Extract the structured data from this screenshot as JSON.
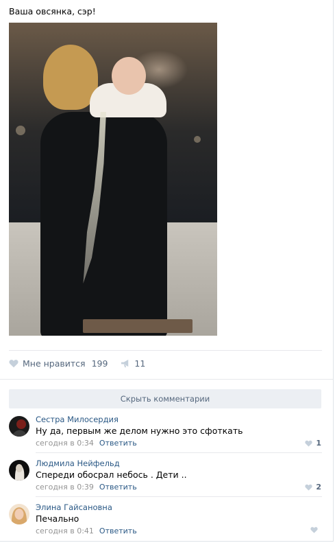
{
  "post": {
    "text": "Ваша овсянка, сэр!",
    "photo_icon": "post-photo"
  },
  "actions": {
    "like_label": "Мне нравится",
    "like_count": "199",
    "share_count": "11",
    "like_icon": "heart-icon",
    "share_icon": "megaphone-icon"
  },
  "comments_toggle": {
    "label": "Скрыть комментарии"
  },
  "comments": [
    {
      "author": "Сестра Милосердия",
      "text": "Ну да, первым же делом нужно это сфоткать",
      "time": "сегодня в 0:34",
      "reply_label": "Ответить",
      "likes": "1"
    },
    {
      "author": "Людмила Нейфельд",
      "text": "Спереди обосрал небось . Дети ..",
      "time": "сегодня в 0:39",
      "reply_label": "Ответить",
      "likes": "2"
    },
    {
      "author": "Элина Гайсановна",
      "text": "Печально",
      "time": "сегодня в 0:41",
      "reply_label": "Ответить",
      "likes": ""
    }
  ],
  "colors": {
    "link": "#2a5885",
    "muted": "#939393",
    "icon": "#55677d",
    "button_bg": "#eceff3",
    "heart": "#c5d0db"
  }
}
